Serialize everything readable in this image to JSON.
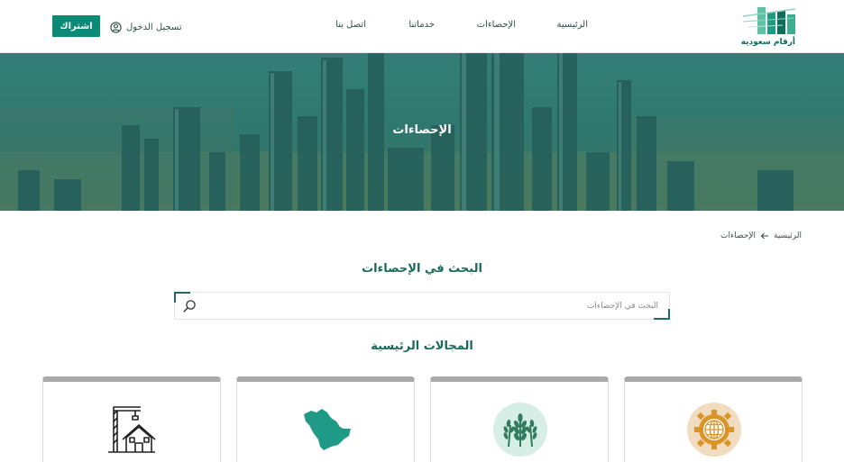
{
  "header": {
    "logo_text": "أرقام سعودية",
    "nav": {
      "home": "الرئيسية",
      "statistics": "الإحصاءات",
      "services": "خدماتنا",
      "contact": "اتصل بنا"
    },
    "login_label": "تسجيل الدخول",
    "subscribe_label": "اشتراك"
  },
  "hero": {
    "title": "الإحصاءات"
  },
  "breadcrumb": {
    "home": "الرئيسية",
    "current": "الإحصاءات"
  },
  "search": {
    "title": "البحث في الإحصاءات",
    "placeholder": "البحث في الإحصاءات",
    "value": ""
  },
  "sectors": {
    "title": "المجالات الرئيسية",
    "cards": [
      {
        "icon": "economy-globe-gear-icon"
      },
      {
        "icon": "agriculture-wheat-icon"
      },
      {
        "icon": "saudi-map-icon"
      },
      {
        "icon": "real-estate-crane-house-icon"
      }
    ]
  },
  "colors": {
    "brand": "#0b8a76",
    "heading": "#17695a",
    "hero_overlay": "#2c6a64",
    "card_top": "#a9a9a9"
  }
}
